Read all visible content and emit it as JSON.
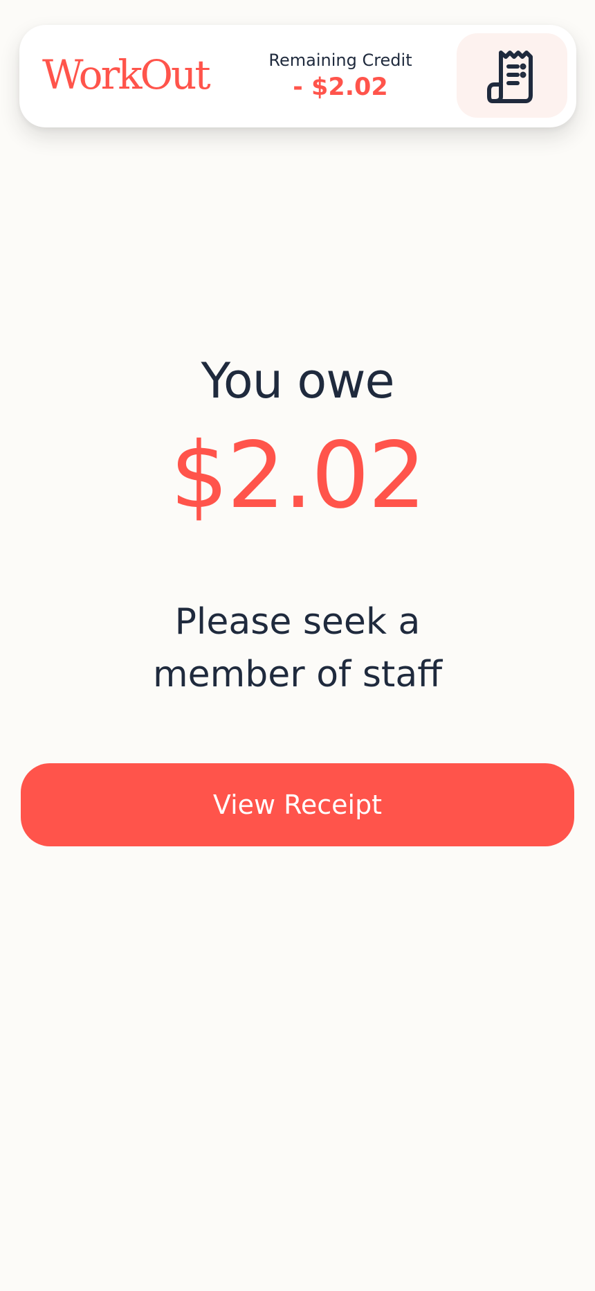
{
  "header": {
    "logo_text": "WorkOut",
    "credit_label": "Remaining Credit",
    "credit_value": "- $2.02",
    "receipt_icon": "receipt-icon"
  },
  "main": {
    "owe_label": "You owe",
    "owe_amount": "$2.02",
    "message": "Please seek a\nmember of  staff",
    "view_receipt_label": "View Receipt"
  },
  "colors": {
    "accent": "#ff544b",
    "text": "#1f2a3d",
    "background": "#fcfbf8",
    "icon_button_bg": "#fdf2ef"
  }
}
